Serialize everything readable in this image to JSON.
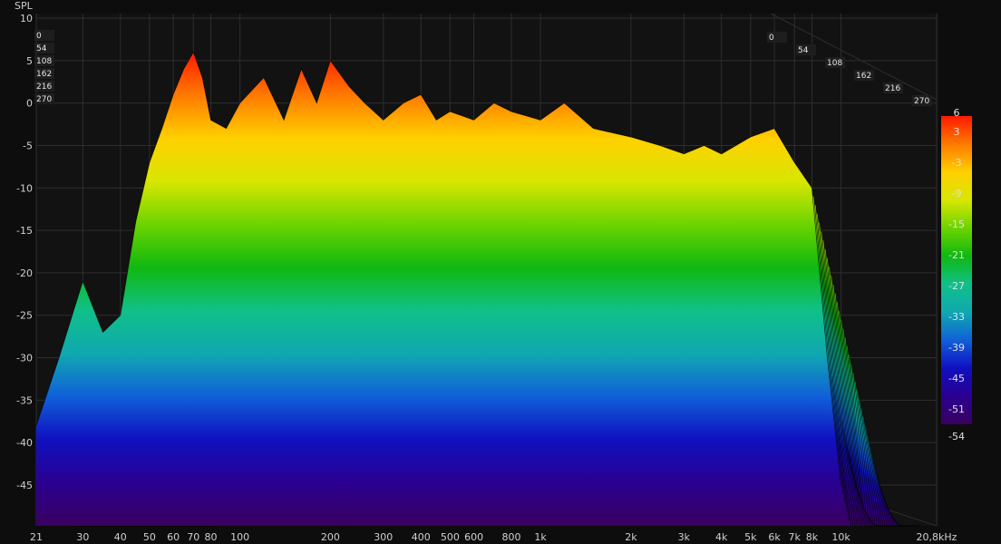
{
  "chart_data": {
    "type": "area",
    "subtype": "waterfall-3d",
    "ylabel": "SPL",
    "y_ticks": [
      "10",
      "5",
      "0",
      "-5",
      "-10",
      "-15",
      "-20",
      "-25",
      "-30",
      "-35",
      "-40",
      "-45"
    ],
    "y_tick_values": [
      10,
      5,
      0,
      -5,
      -10,
      -15,
      -20,
      -25,
      -30,
      -35,
      -40,
      -45
    ],
    "ylim": [
      -50,
      10
    ],
    "x_scale": "log",
    "xlim": [
      21,
      20800
    ],
    "x_ticks": [
      "21",
      "30",
      "40",
      "50",
      "60",
      "70",
      "80",
      "100",
      "200",
      "300",
      "400",
      "500",
      "600",
      "800",
      "1k",
      "2k",
      "3k",
      "4k",
      "5k",
      "6k",
      "7k",
      "8k",
      "10k",
      "20,8kHz"
    ],
    "x_tick_values": [
      21,
      30,
      40,
      50,
      60,
      70,
      80,
      100,
      200,
      300,
      400,
      500,
      600,
      800,
      1000,
      2000,
      3000,
      4000,
      5000,
      6000,
      7000,
      8000,
      10000,
      20800
    ],
    "z_ticks_left": [
      "0",
      "54",
      "108",
      "162",
      "216",
      "270"
    ],
    "z_ticks_right": [
      "0",
      "54",
      "108",
      "162",
      "216",
      "270"
    ],
    "z_tick_values": [
      0,
      54,
      108,
      162,
      216,
      270
    ],
    "colorbar": {
      "ticks": [
        "6",
        "3",
        "-3",
        "-9",
        "-15",
        "-21",
        "-27",
        "-33",
        "-39",
        "-45",
        "-51",
        "-54"
      ],
      "values": [
        6,
        3,
        -3,
        -9,
        -15,
        -21,
        -27,
        -33,
        -39,
        -45,
        -51,
        -54
      ],
      "range": [
        -54,
        6
      ],
      "colors": [
        "#ff1a00",
        "#ff7a00",
        "#ffd000",
        "#d8e600",
        "#6cd400",
        "#10b810",
        "#10c088",
        "#10a8b0",
        "#1060d8",
        "#1010c0",
        "#2a0090",
        "#3a0060"
      ]
    },
    "front_curve": {
      "freq": [
        21,
        25,
        30,
        35,
        40,
        45,
        50,
        55,
        60,
        65,
        70,
        75,
        80,
        90,
        100,
        120,
        140,
        160,
        180,
        200,
        230,
        260,
        300,
        350,
        400,
        450,
        500,
        600,
        700,
        800,
        1000,
        1200,
        1500,
        2000,
        2500,
        3000,
        3500,
        4000,
        5000,
        6000,
        7000,
        8000,
        9000,
        10000
      ],
      "spl": [
        -38,
        -30,
        -21,
        -27,
        -25,
        -14,
        -7,
        -3,
        1,
        4,
        6,
        3,
        -2,
        -3,
        0,
        3,
        -2,
        4,
        0,
        5,
        2,
        0,
        -2,
        0,
        1,
        -2,
        -1,
        -2,
        0,
        -1,
        -2,
        0,
        -3,
        -4,
        -5,
        -6,
        -5,
        -6,
        -4,
        -3,
        -7,
        -10,
        -30,
        -45
      ]
    },
    "grid": true,
    "legend": "colorbar-right"
  }
}
